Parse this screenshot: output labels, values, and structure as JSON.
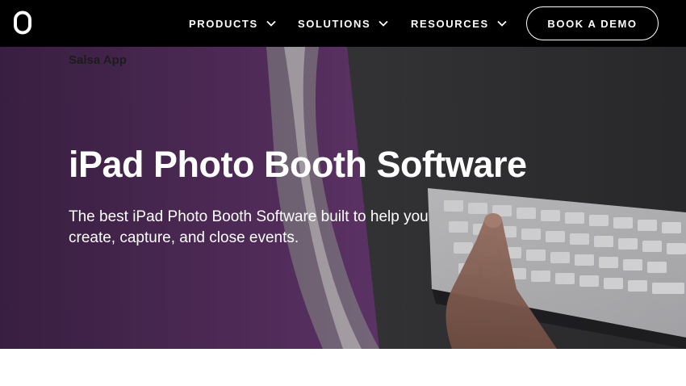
{
  "header": {
    "logo_icon": "zero-logo-icon",
    "nav": [
      {
        "label": "PRODUCTS",
        "icon": "chevron-down-icon"
      },
      {
        "label": "SOLUTIONS",
        "icon": "chevron-down-icon"
      },
      {
        "label": "RESOURCES",
        "icon": "chevron-down-icon"
      }
    ],
    "cta_label": "BOOK A DEMO"
  },
  "hero": {
    "breadcrumb": "Salsa App",
    "title": "iPad Photo Booth Software",
    "subtitle_line1": "The best iPad Photo Booth Software built to help you",
    "subtitle_line2": "create, capture, and close events."
  },
  "colors": {
    "nav_bg": "#000000",
    "hero_purple": "#5b2f66",
    "text_white": "#ffffff"
  }
}
